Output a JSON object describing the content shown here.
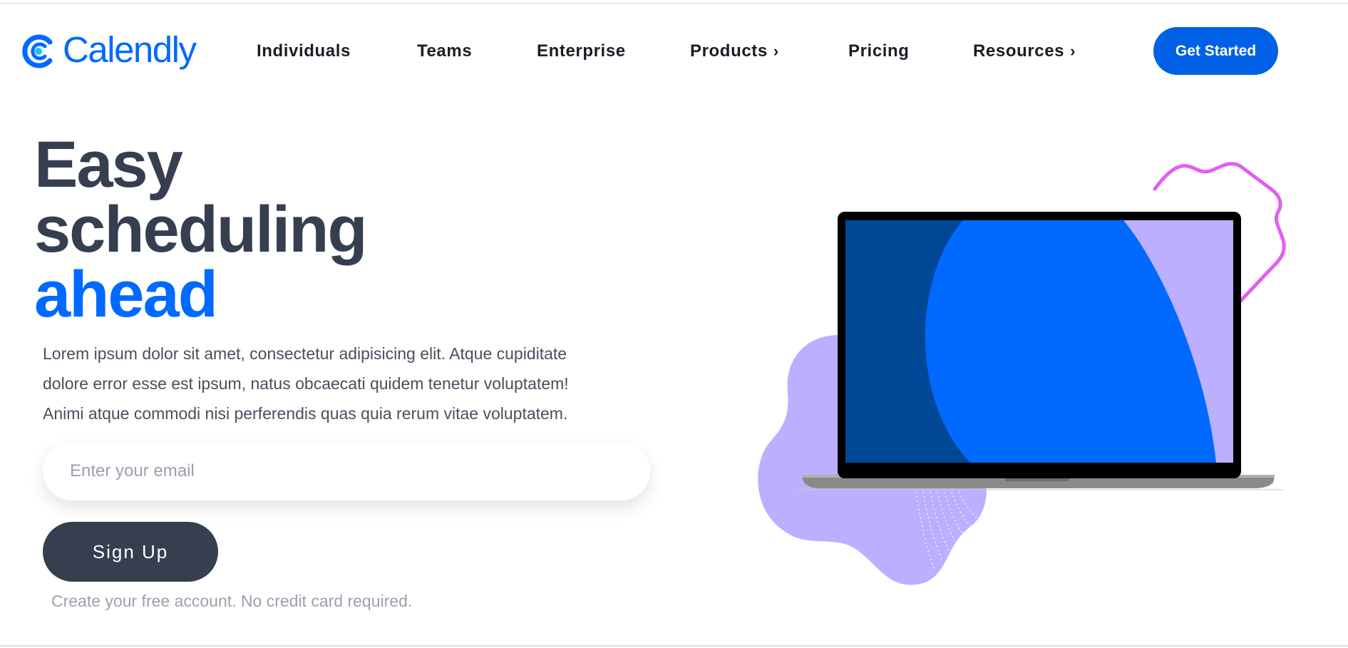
{
  "header": {
    "logo_text": "Calendly",
    "nav": [
      {
        "label": "Individuals",
        "has_chevron": false
      },
      {
        "label": "Teams",
        "has_chevron": false
      },
      {
        "label": "Enterprise",
        "has_chevron": false
      },
      {
        "label": "Products",
        "has_chevron": true
      },
      {
        "label": "Pricing",
        "has_chevron": false
      },
      {
        "label": "Resources",
        "has_chevron": true
      }
    ],
    "chevron_glyph": "›",
    "cta_label": "Get Started"
  },
  "hero": {
    "headline_line1": "Easy",
    "headline_line2": "scheduling",
    "headline_line3": "ahead",
    "description_lines": [
      "Lorem ipsum dolor sit amet, consectetur adipisicing elit. Atque cupiditate",
      "dolore error esse est ipsum, natus obcaecati quidem tenetur voluptatem!",
      "Animi atque commodi nisi perferendis quas quia rerum vitae voluptatem."
    ],
    "email_placeholder": "Enter your email",
    "email_value": "",
    "signup_label": "Sign Up",
    "note": "Create your free account. No credit card required."
  },
  "icons": {
    "logo": "calendly-logo-icon",
    "chevron": "chevron-right-icon"
  },
  "colors": {
    "brand_blue": "#0069ff",
    "cta_blue": "#0060e6",
    "dark_text": "#363f50",
    "muted_text": "#9aa1ad",
    "blob_purple": "#bcafff",
    "outline_magenta": "#e060f0",
    "screen_dark_blue": "#004796"
  }
}
